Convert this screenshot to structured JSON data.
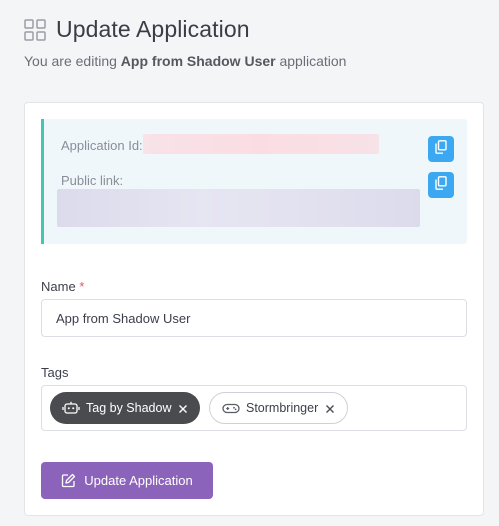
{
  "header": {
    "title": "Update Application",
    "subtitle_prefix": "You are editing ",
    "subtitle_app": "App from Shadow User",
    "subtitle_suffix": " application",
    "icon": "grid-icon"
  },
  "info": {
    "app_id_label": "Application Id:",
    "public_link_label": "Public link:",
    "copy_icon": "copy-icon"
  },
  "form": {
    "name_label": "Name",
    "required_mark": "*",
    "name_value": "App from Shadow User",
    "tags_label": "Tags",
    "tags": [
      {
        "label": "Tag by Shadow",
        "icon": "robot-icon",
        "style": "dark"
      },
      {
        "label": "Stormbringer",
        "icon": "gamepad-icon",
        "style": "outline"
      }
    ],
    "submit_label": "Update Application",
    "submit_icon": "edit-icon"
  },
  "colors": {
    "accent_teal": "#43c7b3",
    "copy_blue": "#3da8f2",
    "submit_purple": "#8c63bb",
    "chip_dark": "#4a4b4f",
    "required_red": "#e0566a"
  }
}
